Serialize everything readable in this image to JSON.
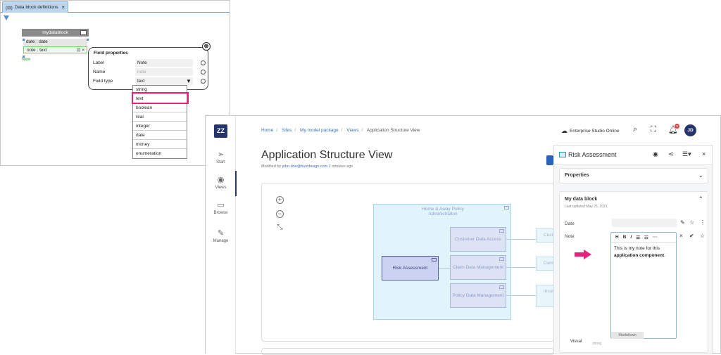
{
  "left_window": {
    "tab_label": "Data block definitions",
    "tab_close": "×",
    "block_name": "mydatablock",
    "fields": [
      {
        "label": "date : date"
      },
      {
        "label": "note : text"
      }
    ],
    "new_label": "New",
    "field_properties": {
      "title": "Field properties",
      "close": "⊗",
      "rows": [
        {
          "key": "Label",
          "value": "Note",
          "placeholder": false
        },
        {
          "key": "Name",
          "value": "note",
          "placeholder": true
        },
        {
          "key": "Field type",
          "value": "text",
          "placeholder": false
        }
      ],
      "dropdown_arrow": "▼"
    },
    "type_options": [
      "string",
      "text",
      "boolean",
      "real",
      "integer",
      "date",
      "money",
      "enumeration"
    ],
    "selected_type": "text"
  },
  "app": {
    "logo": "ZZ",
    "nav": [
      {
        "label": "Start",
        "icon": "send-icon"
      },
      {
        "label": "Views",
        "icon": "eye-icon"
      },
      {
        "label": "Browse",
        "icon": "folder-icon"
      },
      {
        "label": "Manage",
        "icon": "wrench-icon"
      }
    ],
    "breadcrumbs": [
      "Home",
      "Sites",
      "My model package",
      "Views",
      "Application Structure View"
    ],
    "studio": "Enterprise Studio Online",
    "notification_count": "3",
    "avatar": "JD",
    "page_title": "Application Structure View",
    "modified_prefix": "Modified by",
    "modified_user": "john.doe@bizzdesign.com",
    "modified_when": "2 minutes ago",
    "diagram": {
      "group": "Home & Away Policy Administration",
      "components": [
        "Customer Data Access",
        "Claim Data Management",
        "Policy Data Management"
      ],
      "selected": "Risk Assessment",
      "ghosts": [
        "Cust",
        "Dam",
        "Insura"
      ]
    },
    "panel": {
      "title": "Risk Assessment",
      "properties_label": "Properties",
      "datablock_title": "My data block",
      "last_updated": "Last updated May 25, 2021",
      "date_label": "Date",
      "note_label": "Note",
      "toolbar": [
        "H",
        "B",
        "I",
        "☰",
        "☷",
        "···"
      ],
      "note_line1": "This is my note for this",
      "note_line2_bold": "application component",
      "note_line2_end": ".",
      "markdown_tab": "Markdown",
      "visual_tab": "Visual",
      "editing_hint": "ditting"
    }
  },
  "colors": {
    "accent": "#25346b",
    "highlight": "#e0257a",
    "link": "#3a6fb5"
  }
}
